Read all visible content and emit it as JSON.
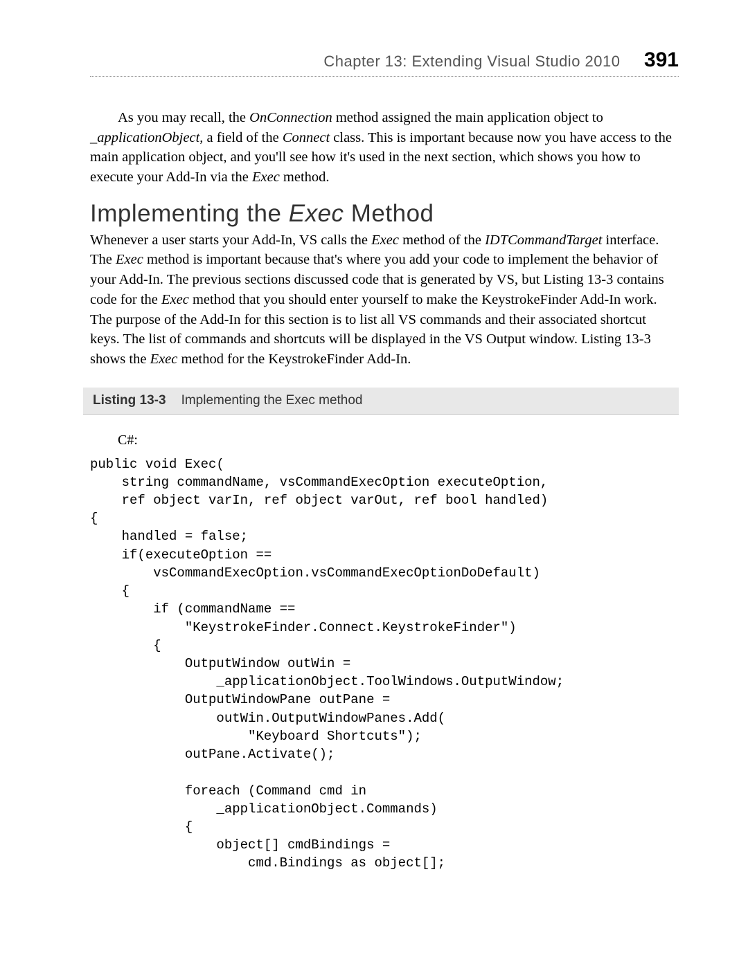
{
  "header": {
    "chapter": "Chapter 13:   Extending Visual Studio 2010",
    "page_number": "391"
  },
  "paragraphs": {
    "p1_1": "As you may recall, the ",
    "p1_on_connection": "OnConnection",
    "p1_2": " method assigned the main application object to ",
    "p1_app_obj": "_applicationObject,",
    "p1_3": " a field of the ",
    "p1_connect": "Connect",
    "p1_4": " class. This is important because now you have access to the main application object, and you'll see how it's used in the next section, which shows you how to execute your Add-In via the ",
    "p1_exec": "Exec",
    "p1_5": " method."
  },
  "heading": {
    "pre": "Implementing the ",
    "exec": "Exec",
    "post": " Method"
  },
  "para2": {
    "t1": "Whenever a user starts your Add-In, VS calls the ",
    "exec1": "Exec",
    "t2": " method of the ",
    "idt": "IDTCommandTarget",
    "t3": " interface. The ",
    "exec2": "Exec",
    "t4": " method is important because that's where you add your code to implement the behavior of your Add-In. The previous sections discussed code that is generated by VS, but Listing 13-3 contains code for the ",
    "exec3": "Exec",
    "t5": " method that you should enter yourself to make the KeystrokeFinder Add-In work. The purpose of the Add-In for this section is to list all VS commands and their associated shortcut keys. The list of commands and shortcuts will be displayed in the VS Output window. Listing 13-3 shows the ",
    "exec4": "Exec",
    "t6": " method for the KeystrokeFinder Add-In."
  },
  "listing": {
    "label": "Listing 13-3",
    "caption": "Implementing the Exec method"
  },
  "code": {
    "lang": "C#:",
    "body": "public void Exec(\n    string commandName, vsCommandExecOption executeOption,\n    ref object varIn, ref object varOut, ref bool handled)\n{\n    handled = false;\n    if(executeOption ==\n        vsCommandExecOption.vsCommandExecOptionDoDefault)\n    {\n        if (commandName ==\n            \"KeystrokeFinder.Connect.KeystrokeFinder\")\n        {\n            OutputWindow outWin =\n                _applicationObject.ToolWindows.OutputWindow;\n            OutputWindowPane outPane =\n                outWin.OutputWindowPanes.Add(\n                    \"Keyboard Shortcuts\");\n            outPane.Activate();\n\n            foreach (Command cmd in\n                _applicationObject.Commands)\n            {\n                object[] cmdBindings =\n                    cmd.Bindings as object[];"
  }
}
